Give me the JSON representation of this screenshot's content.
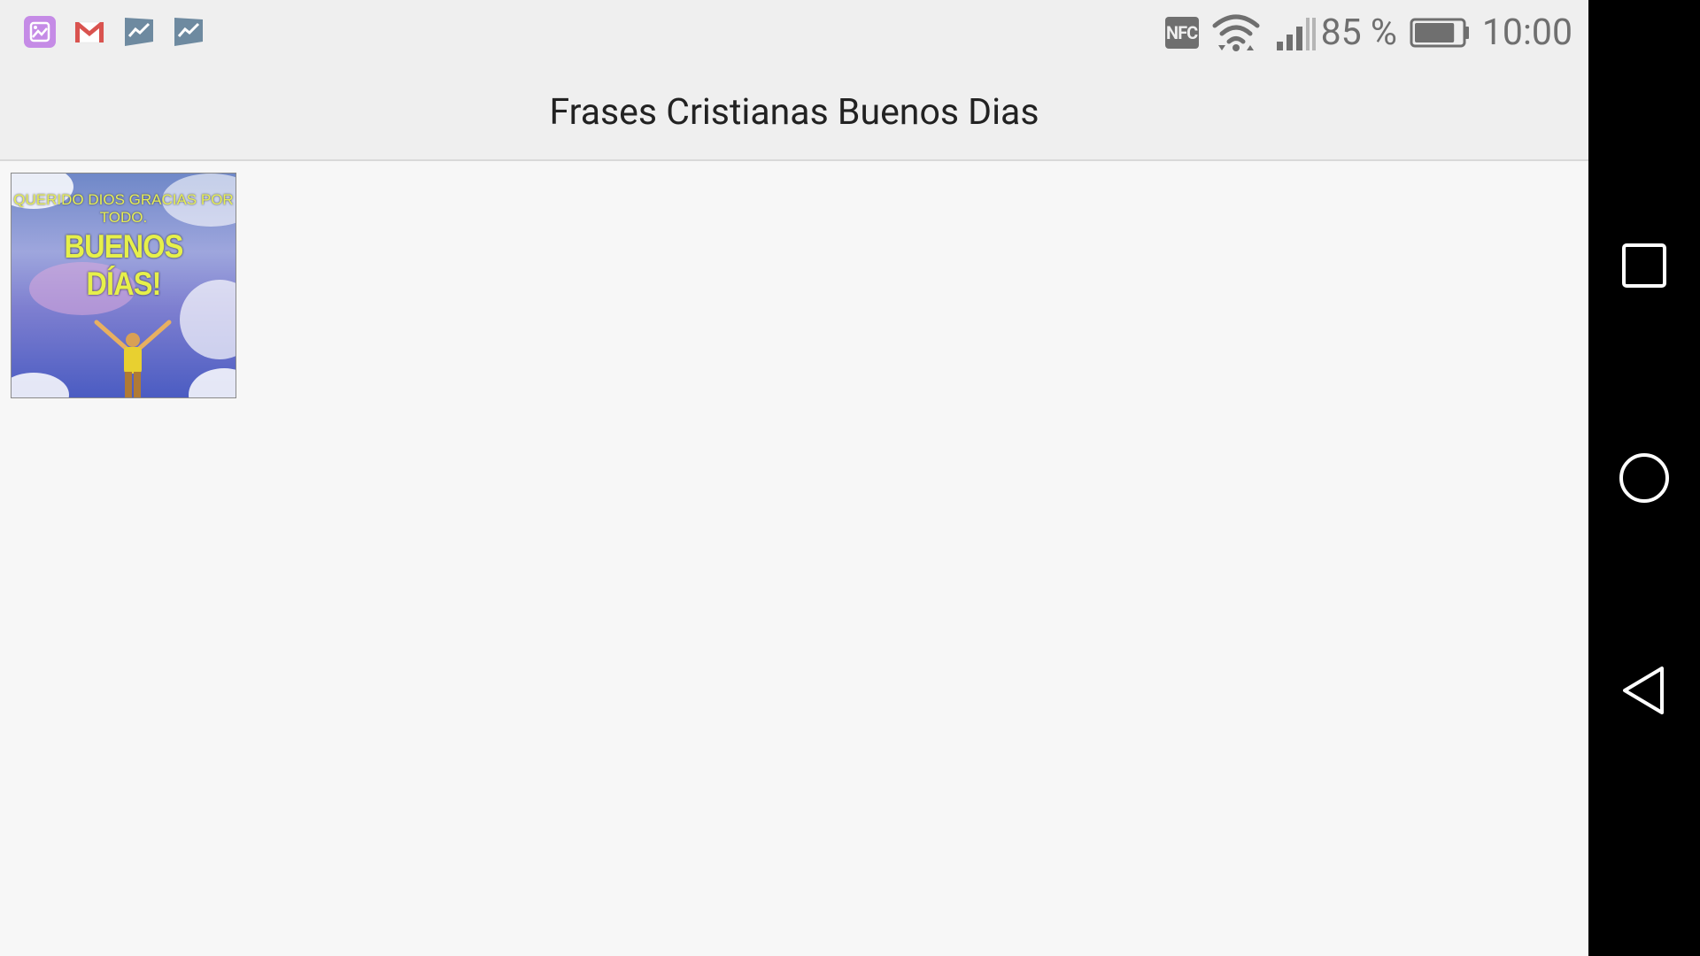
{
  "status_bar": {
    "notifications": [
      "gallery-icon",
      "gmail-icon",
      "play-store-icon",
      "play-store-icon"
    ],
    "nfc_label": "NFC",
    "battery_percent": "85 %",
    "battery_level": 0.85,
    "time": "10:00"
  },
  "toolbar": {
    "title": "Frases Cristianas Buenos Dias"
  },
  "grid": {
    "items": [
      {
        "caption_small": "QUERIDO DIOS GRACIAS POR TODO.",
        "caption_large": "BUENOS DÍAS!"
      }
    ]
  },
  "navigation": {
    "buttons": [
      "recents-icon",
      "home-icon",
      "back-icon"
    ]
  },
  "colors": {
    "status_bar_bg": "#efefef",
    "content_bg": "#f7f7f7",
    "navbar_bg": "#000000",
    "title_text": "#222222"
  }
}
